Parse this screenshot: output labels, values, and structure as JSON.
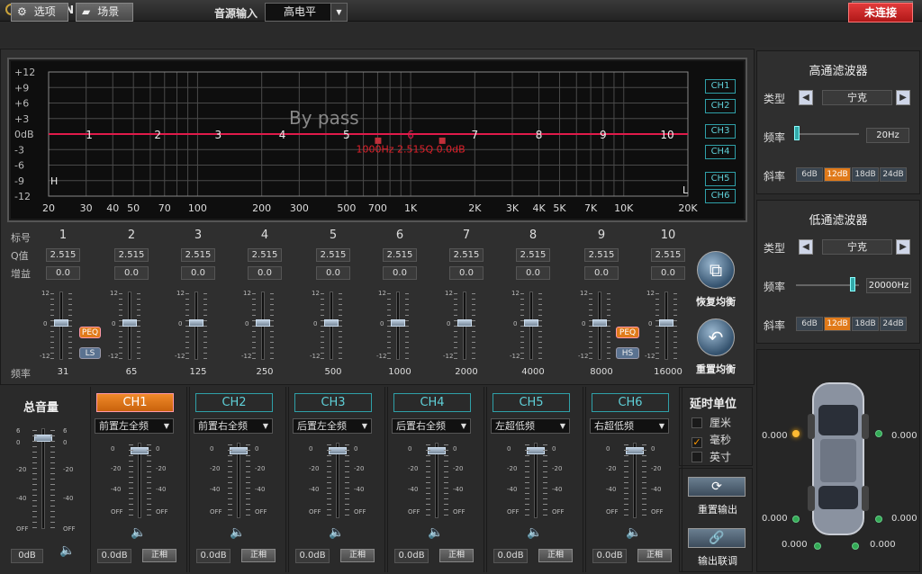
{
  "app": {
    "logo": "GLADENR",
    "min": "_",
    "close": "✕"
  },
  "toolbar": {
    "options": "选项",
    "scene": "场景",
    "source_label": "音源输入",
    "source_value": "高电平",
    "connect": "未连接"
  },
  "graph": {
    "bypass": "By pass",
    "marker": "1000Hz 2.515Q 0.0dB",
    "y_ticks": [
      "+12",
      "+9",
      "+6",
      "+3",
      "0dB",
      "-3",
      "-6",
      "-9",
      "-12"
    ],
    "x_ticks": [
      "20",
      "30",
      "40",
      "50",
      "70",
      "100",
      "200",
      "300",
      "500",
      "700",
      "1K",
      "2K",
      "3K",
      "4K",
      "5K",
      "7K",
      "10K",
      "20K"
    ],
    "corner_h": "H",
    "corner_l": "L",
    "point_labels": [
      "1",
      "2",
      "3",
      "4",
      "5",
      "6",
      "7",
      "8",
      "9",
      "10"
    ],
    "ch_buttons": [
      "CH1",
      "CH2",
      "CH3",
      "CH4",
      "CH5",
      "CH6"
    ]
  },
  "chart_data": {
    "type": "line",
    "title": "By pass",
    "xlabel": "",
    "ylabel": "",
    "x_scale": "log",
    "xlim": [
      20,
      20000
    ],
    "ylim": [
      -12,
      12
    ],
    "series": [
      {
        "values": [
          0,
          0
        ]
      }
    ],
    "x": [
      20,
      20000
    ],
    "bands": [
      {
        "n": 1,
        "freq": 31,
        "gain": 0
      },
      {
        "n": 2,
        "freq": 65,
        "gain": 0
      },
      {
        "n": 3,
        "freq": 125,
        "gain": 0
      },
      {
        "n": 4,
        "freq": 250,
        "gain": 0
      },
      {
        "n": 5,
        "freq": 500,
        "gain": 0
      },
      {
        "n": 6,
        "freq": 1000,
        "gain": 0
      },
      {
        "n": 7,
        "freq": 2000,
        "gain": 0
      },
      {
        "n": 8,
        "freq": 4000,
        "gain": 0
      },
      {
        "n": 9,
        "freq": 8000,
        "gain": 0
      },
      {
        "n": 10,
        "freq": 16000,
        "gain": 0
      }
    ]
  },
  "eq": {
    "row_label": "标号",
    "q_label": "Q值",
    "gain_label": "增益",
    "freq_label": "频率",
    "bands": [
      {
        "num": "1",
        "q": "2.515",
        "gain": "0.0",
        "freq": "31"
      },
      {
        "num": "2",
        "q": "2.515",
        "gain": "0.0",
        "freq": "65"
      },
      {
        "num": "3",
        "q": "2.515",
        "gain": "0.0",
        "freq": "125"
      },
      {
        "num": "4",
        "q": "2.515",
        "gain": "0.0",
        "freq": "250"
      },
      {
        "num": "5",
        "q": "2.515",
        "gain": "0.0",
        "freq": "500"
      },
      {
        "num": "6",
        "q": "2.515",
        "gain": "0.0",
        "freq": "1000"
      },
      {
        "num": "7",
        "q": "2.515",
        "gain": "0.0",
        "freq": "2000"
      },
      {
        "num": "8",
        "q": "2.515",
        "gain": "0.0",
        "freq": "4000"
      },
      {
        "num": "9",
        "q": "2.515",
        "gain": "0.0",
        "freq": "8000"
      },
      {
        "num": "10",
        "q": "2.515",
        "gain": "0.0",
        "freq": "16000"
      }
    ],
    "slider_ticks": [
      "12",
      "0",
      "-12"
    ],
    "peq": "PEQ",
    "ls": "LS",
    "hs": "HS",
    "restore": "恢复均衡",
    "reset": "重置均衡"
  },
  "hpf": {
    "title": "高通滤波器",
    "type_label": "类型",
    "type_value": "宁克",
    "freq_label": "频率",
    "freq_value": "20Hz",
    "slope_label": "斜率",
    "slopes": [
      "6dB",
      "12dB",
      "18dB",
      "24dB"
    ]
  },
  "lpf": {
    "title": "低通滤波器",
    "type_label": "类型",
    "type_value": "宁克",
    "freq_label": "频率",
    "freq_value": "20000Hz",
    "slope_label": "斜率",
    "slopes": [
      "6dB",
      "12dB",
      "18dB",
      "24dB"
    ]
  },
  "master": {
    "title": "总音量",
    "value": "0dB",
    "ticks": [
      "6",
      "0",
      "-20",
      "-40",
      "OFF"
    ]
  },
  "channels": [
    {
      "name": "CH1",
      "assign": "前置左全频",
      "vol": "0.0dB",
      "phase": "正相"
    },
    {
      "name": "CH2",
      "assign": "前置右全频",
      "vol": "0.0dB",
      "phase": "正相"
    },
    {
      "name": "CH3",
      "assign": "后置左全频",
      "vol": "0.0dB",
      "phase": "正相"
    },
    {
      "name": "CH4",
      "assign": "后置右全频",
      "vol": "0.0dB",
      "phase": "正相"
    },
    {
      "name": "CH5",
      "assign": "左超低频",
      "vol": "0.0dB",
      "phase": "正相"
    },
    {
      "name": "CH6",
      "assign": "右超低频",
      "vol": "0.0dB",
      "phase": "正相"
    }
  ],
  "ch_ticks": [
    "0",
    "-20",
    "-40",
    "OFF"
  ],
  "delay": {
    "title": "延时单位",
    "units": [
      "厘米",
      "毫秒",
      "英寸"
    ],
    "selected": 1,
    "reset_out": "重置输出",
    "link_out": "输出联调"
  },
  "car": {
    "v1": "0.000",
    "v2": "0.000",
    "v3": "0.000",
    "v4": "0.000",
    "v5": "0.000",
    "v6": "0.000"
  }
}
